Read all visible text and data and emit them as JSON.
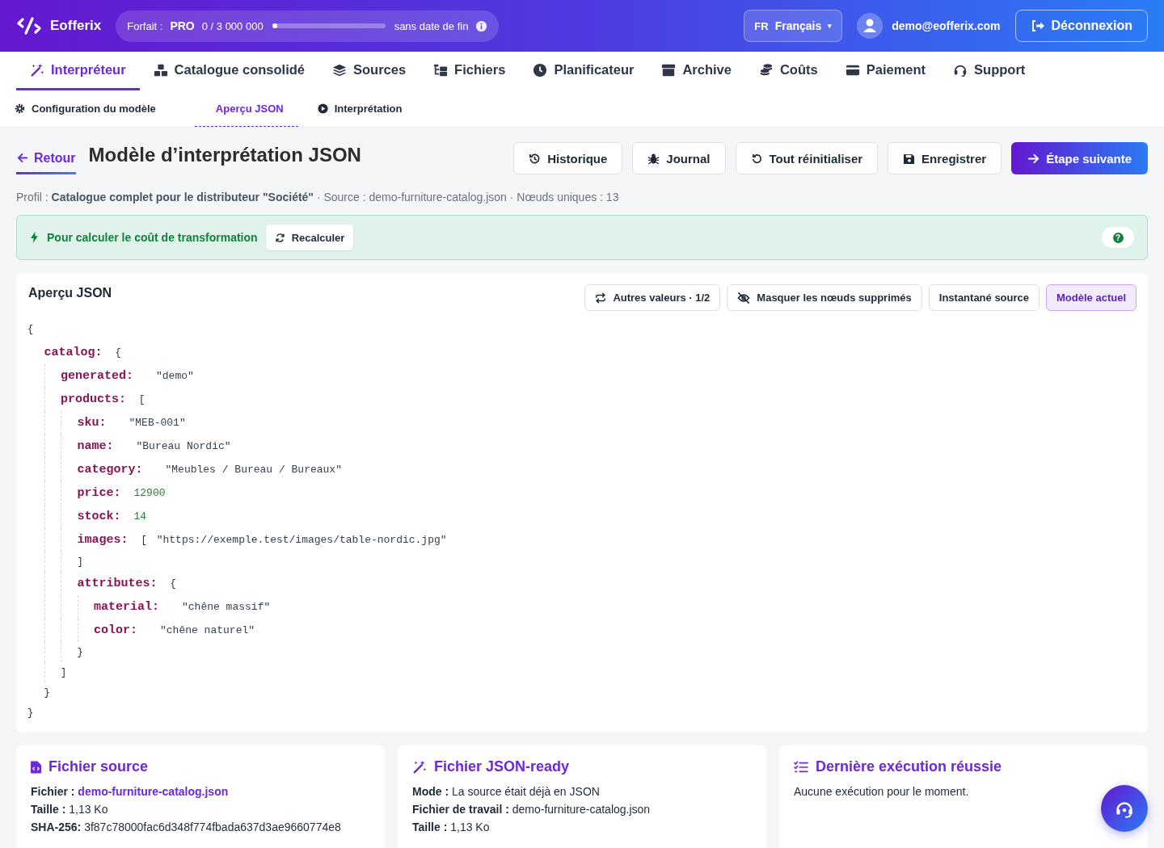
{
  "header": {
    "brand": "Eofferix",
    "plan": {
      "label": "Forfait :",
      "name": "PRO",
      "usage": "0 / 3 000 000",
      "level": 0,
      "expiry": "sans date de fin"
    },
    "language": {
      "code": "FR",
      "label": "Français",
      "caret": "▾"
    },
    "user": "demo@eofferix.com",
    "logout": "Déconnexion"
  },
  "nav": [
    {
      "label": "Interpréteur",
      "selected": true
    },
    {
      "label": "Catalogue consolidé",
      "selected": false
    },
    {
      "label": "Sources",
      "selected": false
    },
    {
      "label": "Fichiers",
      "selected": false
    },
    {
      "label": "Planificateur",
      "selected": false
    },
    {
      "label": "Archive",
      "selected": false
    },
    {
      "label": "Coûts",
      "selected": false
    },
    {
      "label": "Paiement",
      "selected": false
    },
    {
      "label": "Support",
      "selected": false
    }
  ],
  "subtabs": [
    {
      "label": "Configuration du modèle",
      "selected": false
    },
    {
      "label": "Aperçu JSON",
      "selected": true
    },
    {
      "label": "Interprétation",
      "selected": false
    }
  ],
  "page": {
    "back": "Retour",
    "title": "Modèle d’interprétation JSON",
    "actions": [
      {
        "label": "Historique",
        "kind": "secondary"
      },
      {
        "label": "Journal",
        "kind": "secondary"
      },
      {
        "label": "Tout réinitialiser",
        "kind": "secondary"
      },
      {
        "label": "Enregistrer",
        "kind": "secondary"
      },
      {
        "label": "Étape suivante",
        "kind": "primary"
      }
    ],
    "summary": "Profil : **Catalogue complet pour le distributeur \"Société\"** · Source : demo-furniture-catalog.json · Nœuds uniques : 13"
  },
  "alert": {
    "text": "Pour calculer le coût de transformation",
    "button": "Recalculer",
    "help": "?"
  },
  "preview": {
    "title": "Aperçu JSON",
    "toggles": [
      {
        "label": "Autres valeurs · 1/2",
        "selected": false
      },
      {
        "label": "Masquer les nœuds supprimés",
        "selected": false
      },
      {
        "label": "Instantané source",
        "selected": false
      },
      {
        "label": "Modèle actuel",
        "selected": true
      }
    ],
    "json": {
      "open": "{",
      "close": "}",
      "children": [
        {
          "key": "catalog:",
          "open": "{",
          "close": "}",
          "children": [
            {
              "key": "generated:",
              "value": "\"demo\"",
              "kind": "string"
            },
            {
              "key": "products:",
              "open": "[",
              "close": "]",
              "children": [
                {
                  "key": "sku:",
                  "value": "\"MEB-001\"",
                  "kind": "string"
                },
                {
                  "key": "name:",
                  "value": "\"Bureau Nordic\"",
                  "kind": "string"
                },
                {
                  "key": "category:",
                  "value": "\"Meubles / Bureau / Bureaux\"",
                  "kind": "string"
                },
                {
                  "key": "price:",
                  "value": "12900",
                  "kind": "number"
                },
                {
                  "key": "stock:",
                  "value": "14",
                  "kind": "number"
                },
                {
                  "key": "images:",
                  "open": "[",
                  "value": "\"https://exemple.test/images/table-nordic.jpg\"",
                  "kind": "string",
                  "close": "]"
                },
                {
                  "key": "attributes:",
                  "open": "{",
                  "close": "}",
                  "children": [
                    {
                      "key": "material:",
                      "value": "\"chêne massif\"",
                      "kind": "string"
                    },
                    {
                      "key": "color:",
                      "value": "\"chêne naturel\"",
                      "kind": "string"
                    }
                  ]
                }
              ]
            }
          ]
        }
      ]
    }
  },
  "cards": [
    {
      "title": "Fichier source",
      "rows": [
        {
          "label": "Fichier :",
          "value": "demo-furniture-catalog.json",
          "kind": "link"
        },
        {
          "label": "Taille :",
          "value": "1,13 Ko",
          "kind": "text"
        },
        {
          "label": "SHA-256:",
          "value": "3f87c78000fac6d348f774fbada637d3ae9660774e8",
          "kind": "text"
        }
      ]
    },
    {
      "title": "Fichier JSON-ready",
      "rows": [
        {
          "label": "Mode :",
          "value": "La source était déjà en JSON",
          "kind": "text"
        },
        {
          "label": "Fichier de travail :",
          "value": "demo-furniture-catalog.json",
          "kind": "text"
        },
        {
          "label": "Taille :",
          "value": "1,13 Ko",
          "kind": "text"
        }
      ]
    },
    {
      "title": "Dernière exécution réussie",
      "text": "Aucune exécution pour le moment."
    }
  ]
}
